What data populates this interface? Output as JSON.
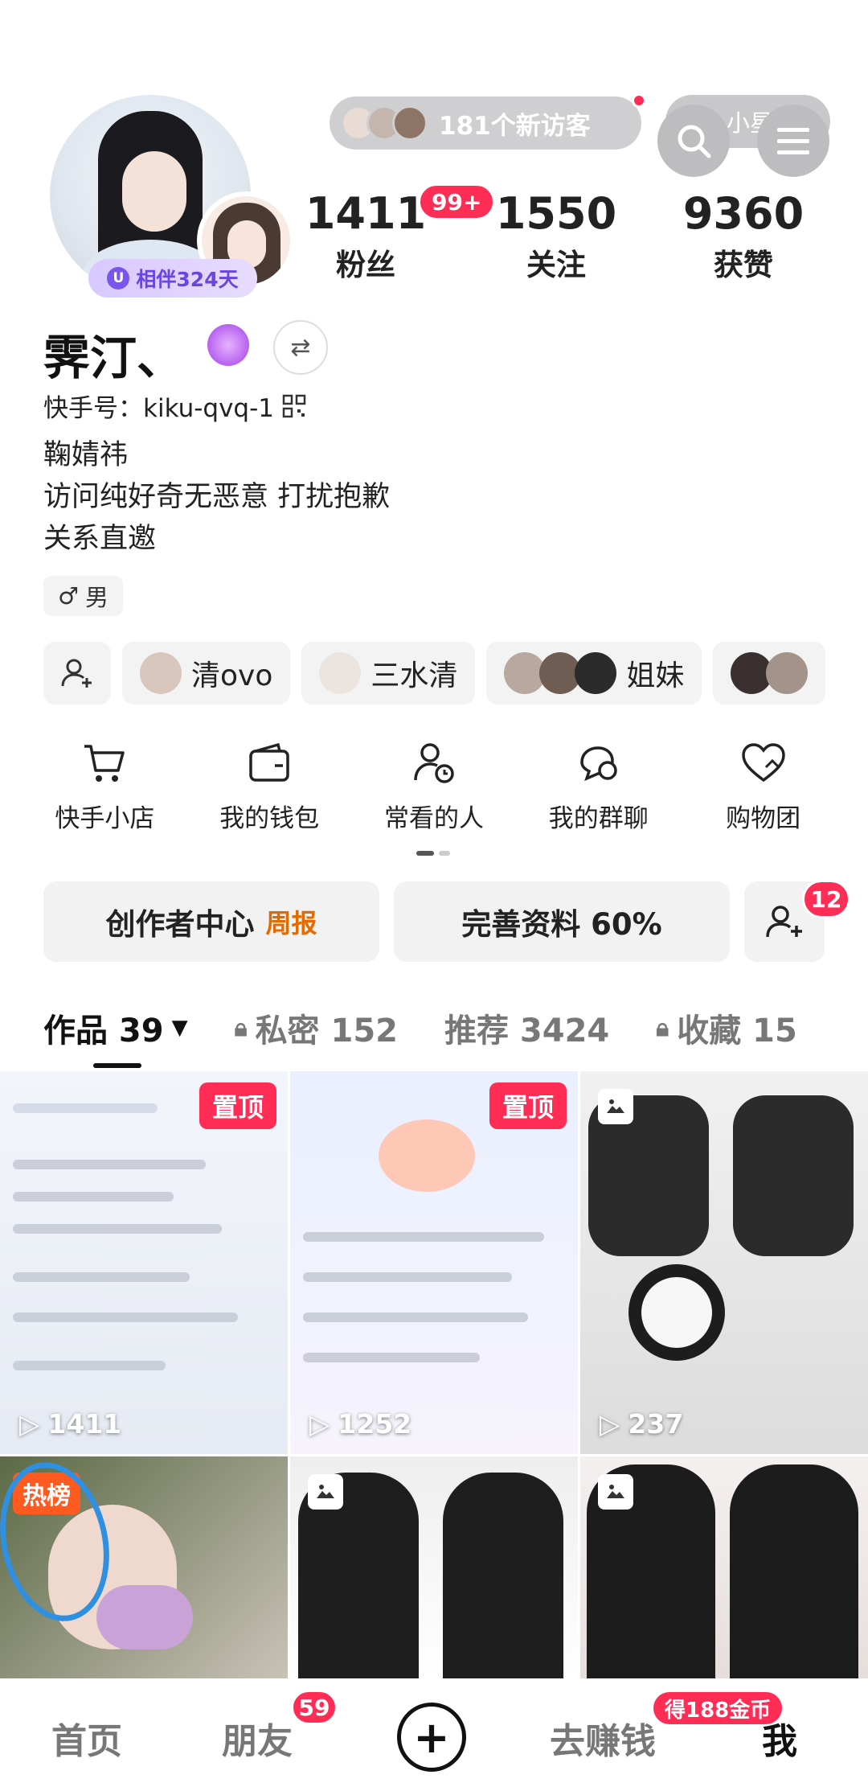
{
  "header": {
    "visitors_text": "181个新访客",
    "planet_label": "小星球",
    "companion_label": "相伴324天"
  },
  "stats": {
    "fans": {
      "value": "1411",
      "label": "粉丝",
      "badge": "99+"
    },
    "following": {
      "value": "1550",
      "label": "关注"
    },
    "likes": {
      "value": "9360",
      "label": "获赞"
    }
  },
  "profile": {
    "name": "霁汀、",
    "kuaishou_id": "快手号：kiku-qvq-1",
    "bio": [
      "鞠婧祎",
      "访问纯好奇无恶意 打扰抱歉",
      "关系直邀"
    ],
    "gender": "男"
  },
  "friends": [
    "清ovo",
    "三水清",
    "姐妹"
  ],
  "shortcuts": [
    "快手小店",
    "我的钱包",
    "常看的人",
    "我的群聊",
    "购物团"
  ],
  "actions": {
    "creator_center": "创作者中心",
    "weekly": "周报",
    "complete_profile": "完善资料 60%",
    "add_friend_badge": "12"
  },
  "tabs": [
    {
      "label": "作品 39",
      "active": true
    },
    {
      "label": "私密 152",
      "locked": true
    },
    {
      "label": "推荐 3424"
    },
    {
      "label": "收藏 15",
      "locked": true
    }
  ],
  "grid": {
    "pin_label": "置顶",
    "hot_label": "热榜",
    "play_counts": [
      "1411",
      "1252",
      "237"
    ]
  },
  "bottom_nav": {
    "home": "首页",
    "friends": "朋友",
    "friends_badge": "59",
    "earn": "去赚钱",
    "earn_badge": "得188金币",
    "me": "我"
  },
  "colors": {
    "accent": "#ff2d55",
    "weekly": "#e36a00",
    "hot": "#ff5a1f",
    "companion": "#6a45e0"
  }
}
